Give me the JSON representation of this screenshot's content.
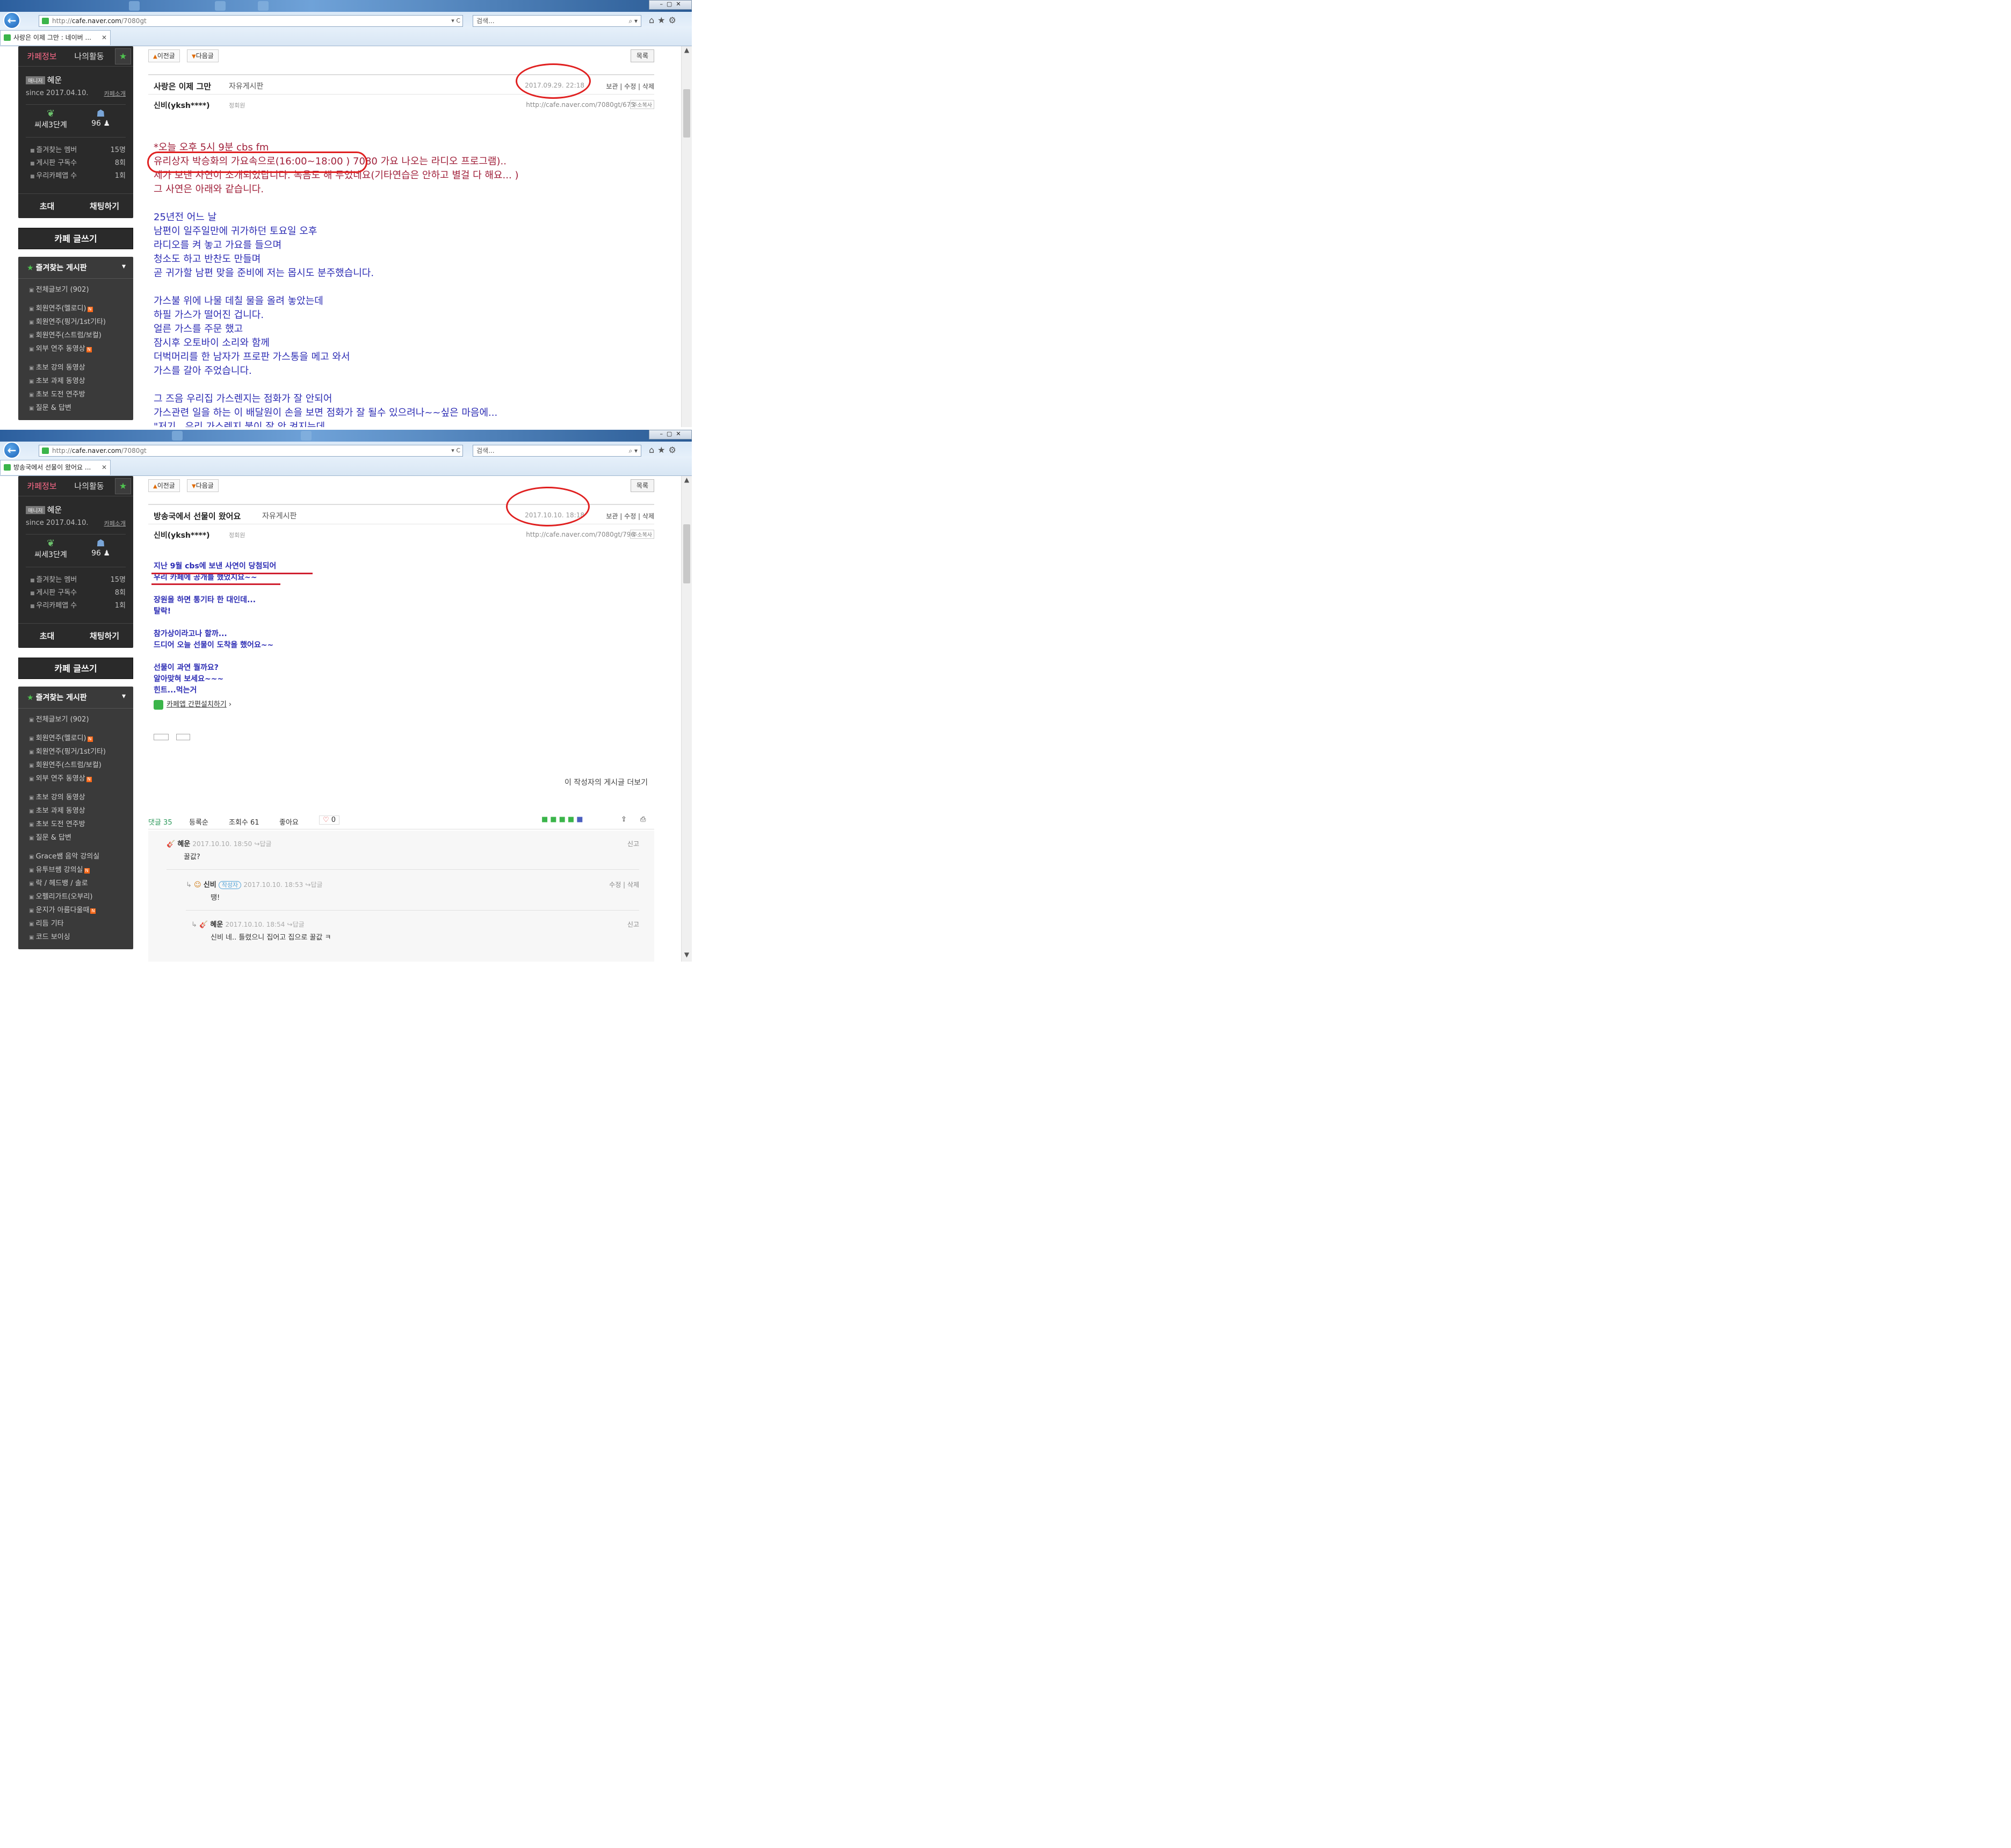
{
  "browser": {
    "url_prefix": "http://",
    "url_domain1": "cafe.naver.com",
    "url_path1": "/7080gt",
    "url_domain2": "cafe.naver.com",
    "url_path2": "/7080gt",
    "search_text": "검색...",
    "tab1_title": "사랑은 이제 그만 : 네이버 ...",
    "tab2_title": "방송국에서 선물이 왔어요 ..."
  },
  "sidebar": {
    "tab_cafe": "카페정보",
    "tab_my": "나의활동",
    "nickname": "혜운",
    "level_badge": "매니저",
    "since": "since 2017.04.10.",
    "intro_link": "카페소개",
    "stage": "씨세3단계",
    "members": "96",
    "stats": [
      {
        "label": "즐겨찾는 멤버",
        "value": "15명"
      },
      {
        "label": "게시판 구독수",
        "value": "8회"
      },
      {
        "label": "우리카페앱 수",
        "value": "1회"
      }
    ],
    "invite": "초대",
    "chat": "채팅하기",
    "write": "카페 글쓰기",
    "fav_boards": "즐겨찾는 게시판",
    "menu1": [
      "전체글보기 (902)",
      "회원연주(멜로디)",
      "회원연주(핑거/1st기타)",
      "회원연주(스트럼/보컬)",
      "외부 연주 동영상",
      "초보 강의 동영상",
      "초보 과제 동영상",
      "초보 도전 연주방",
      "질문 & 답변"
    ],
    "menu2": [
      "전체글보기 (902)",
      "회원연주(멜로디)",
      "회원연주(핑거/1st기타)",
      "회원연주(스트럼/보컬)",
      "외부 연주 동영상",
      "초보 강의 동영상",
      "초보 과제 동영상",
      "초보 도전 연주방",
      "질문 & 답변",
      "Grace쌤 음악 강의실",
      "유투브쌤 강의실",
      "락 / 헤드뱅 / 솔로",
      "오펠리가트(오부리)",
      "운지가 아름다울때",
      "리듬 기타",
      "코드 보이싱"
    ]
  },
  "nav": {
    "prev": "이전글",
    "next": "다음글",
    "list": "목록"
  },
  "post1": {
    "title": "사랑은 이제 그만",
    "board": "자유게시판",
    "date": "2017.09.29. 22:18",
    "acts": "보관 | 수정 | 삭제",
    "author": "신비(yksh****)",
    "grade": "정회원",
    "url": "http://cafe.naver.com/7080gt/675",
    "copy": "주소복사",
    "lines_red": [
      "*오늘 오후 5시 9분 cbs fm",
      "유리상자 박승화의 가요속으로(16:00~18:00 ) 7080 가요 나오는 라디오 프로그램)..",
      "제가 보낸 사연이 소개되었답니다. 녹음도 해 두었네요(기타연습은 안하고 별걸 다 해요... )",
      "그 사연은 아래와 같습니다."
    ],
    "lines_blue": [
      "25년전 어느 날",
      "남편이 일주일만에 귀가하던 토요일 오후",
      "라디오를 켜 놓고 가요를 들으며",
      "청소도 하고 반찬도 만들며",
      "곧 귀가할 남편 맞을 준비에 저는 몹시도 분주했습니다.",
      "",
      "가스불 위에 나물 데칠 물을 올려 놓았는데",
      "하필 가스가 떨어진 겁니다.",
      "얼른 가스를 주문 했고",
      "잠시후 오토바이 소리와 함께",
      "더벅머리를 한 남자가 프로판 가스통을 메고 와서",
      "가스를 갈아 주었습니다.",
      "",
      "그 즈음 우리집 가스렌지는 점화가 잘 안되어",
      "가스관련 일을 하는 이 배달원이 손을 보면 점화가 잘 될수 있으려나~~싶은 마음에...",
      "\"저기...우리 가스렌지 불이 잘 안 켜지는데.."
    ]
  },
  "post2": {
    "title": "방송국에서 선물이 왔어요",
    "board": "자유게시판",
    "date": "2017.10.10. 18:18",
    "acts": "보관 | 수정 | 삭제",
    "author": "신비(yksh****)",
    "grade": "정회원",
    "url": "http://cafe.naver.com/7080gt/796",
    "copy": "주소복사",
    "lines": [
      "지난 9월 cbs에 보낸 사연이 당첨되어",
      "우리 카페에 공개를 했었지요~~",
      "",
      "장원을 하면 통기타 한 대인데...",
      "탈락!",
      "",
      "참가상이라고나 할까...",
      "드디어 오늘 선물이 도착을 했어요~~",
      "",
      "선물이 과연 뭘까요?",
      "알아맞혀 보세요~~~",
      "힌트...먹는거"
    ],
    "app_link": "카페앱 간편설치하기",
    "author_more": "이 작성자의 게시글 더보기",
    "comments_label": "댓글 35",
    "sort": "등록순",
    "views": "조회수 61",
    "likes_label": "좋아요",
    "likes": "0",
    "comments": [
      {
        "name": "혜운",
        "meta": "2017.10.10. 18:50",
        "reply": "답글",
        "text": "꿀값?",
        "right": "신고"
      },
      {
        "name": "신비",
        "badge": "작성자",
        "meta": "2017.10.10. 18:53",
        "reply": "답글",
        "text": "땡!",
        "right": "수정 | 삭제"
      },
      {
        "name": "혜운",
        "meta": "2017.10.10. 18:54",
        "reply": "답글",
        "text": "신비 네.. 틀렸으니 집어고 집으로 꿀값 ㅋ",
        "right": "신고"
      }
    ]
  }
}
